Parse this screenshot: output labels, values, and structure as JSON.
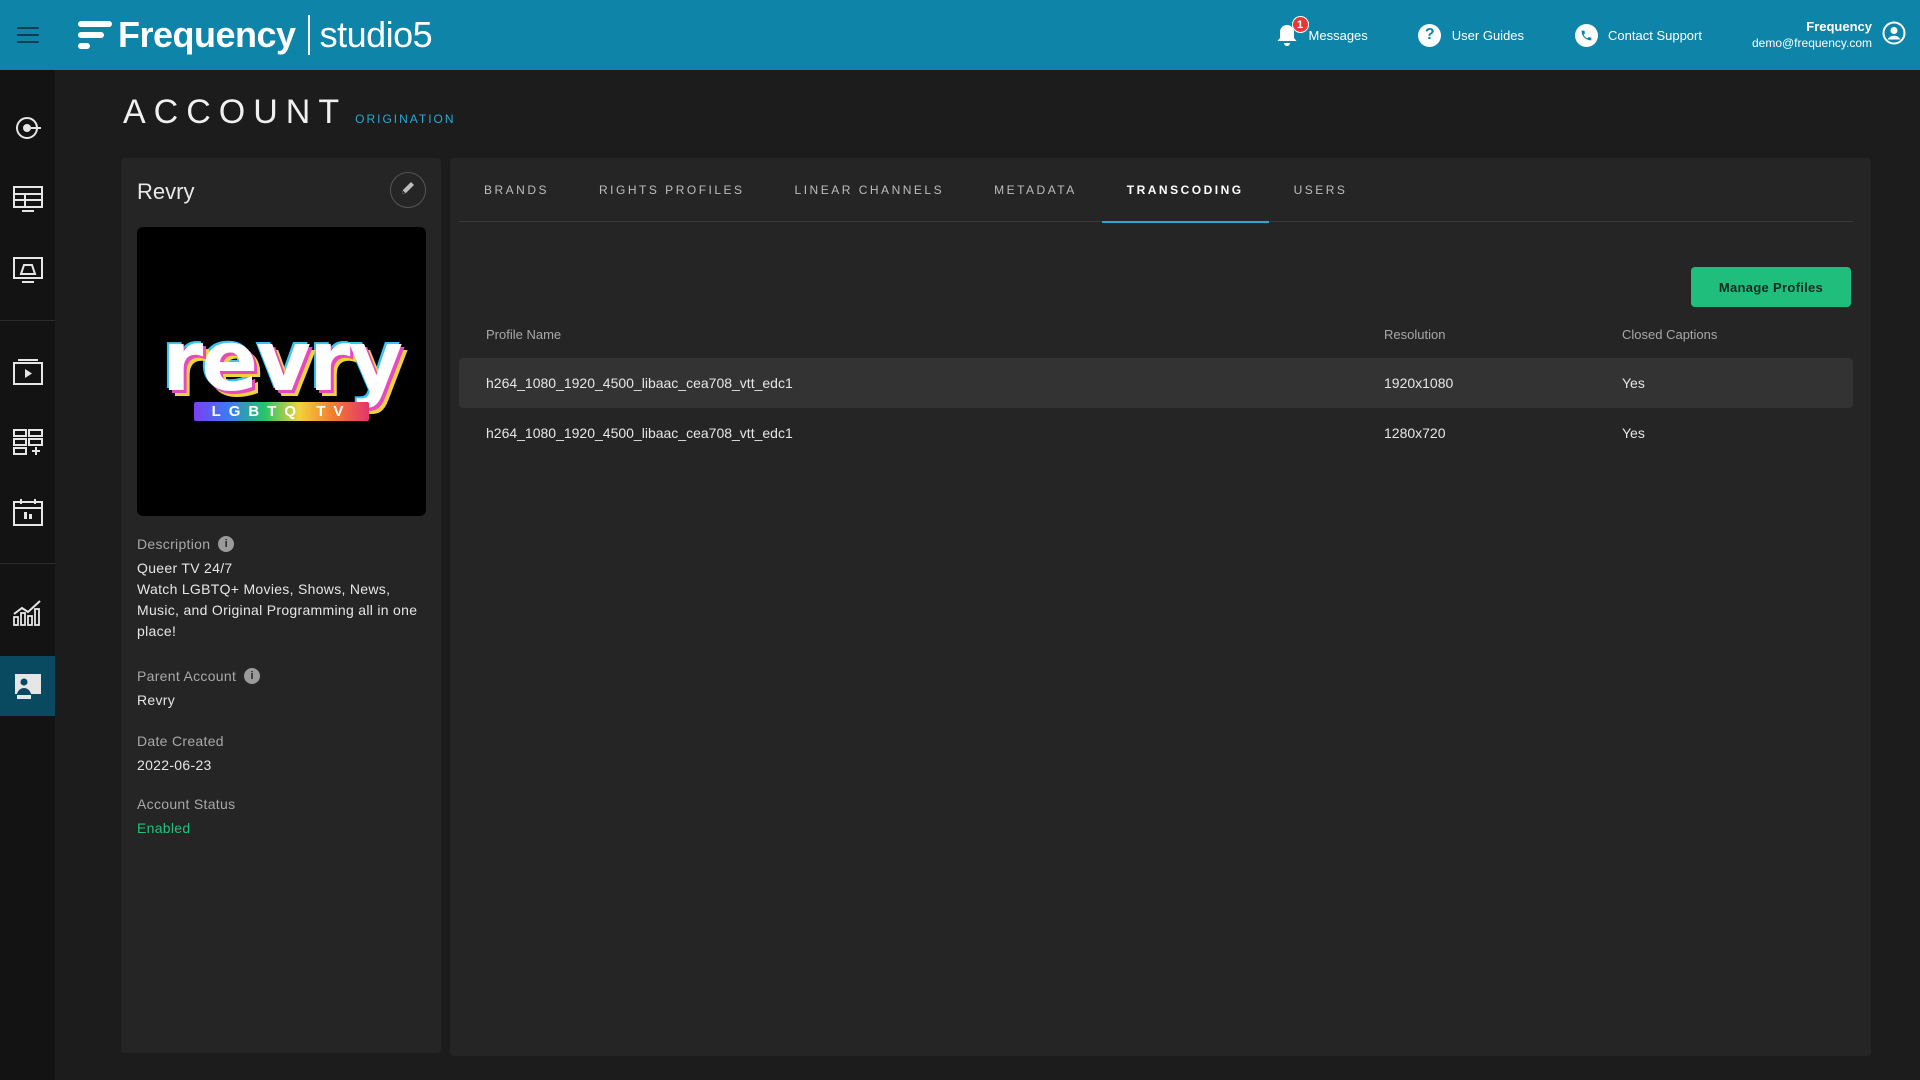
{
  "header": {
    "brand": "Frequency",
    "product": "studio5",
    "messages_label": "Messages",
    "messages_count": "1",
    "guides_label": "User Guides",
    "support_label": "Contact Support",
    "user_name": "Frequency",
    "user_email": "demo@frequency.com"
  },
  "page": {
    "title": "ACCOUNT",
    "subtitle": "ORIGINATION"
  },
  "account": {
    "name": "Revry",
    "logo_word": "revry",
    "logo_sub": "LGBTQ TV",
    "description_label": "Description",
    "description": "Queer TV 24/7\nWatch LGBTQ+ Movies, Shows, News, Music, and Original Programming all in one place!",
    "description_line1": "Queer TV 24/7",
    "description_line2": "Watch LGBTQ+ Movies, Shows, News, Music, and Original Programming all in one place!",
    "parent_label": "Parent Account",
    "parent": "Revry",
    "created_label": "Date Created",
    "created": "2022-06-23",
    "status_label": "Account Status",
    "status": "Enabled"
  },
  "tabs": [
    {
      "label": "BRANDS"
    },
    {
      "label": "RIGHTS PROFILES"
    },
    {
      "label": "LINEAR CHANNELS"
    },
    {
      "label": "METADATA"
    },
    {
      "label": "TRANSCODING"
    },
    {
      "label": "USERS"
    }
  ],
  "transcoding": {
    "manage_label": "Manage Profiles",
    "columns": [
      "Profile Name",
      "Resolution",
      "Closed Captions"
    ],
    "rows": [
      {
        "name": "h264_1080_1920_4500_libaac_cea708_vtt_edc1",
        "resolution": "1920x1080",
        "captions": "Yes"
      },
      {
        "name": "h264_1080_1920_4500_libaac_cea708_vtt_edc1",
        "resolution": "1280x720",
        "captions": "Yes"
      }
    ]
  },
  "colors": {
    "header_bg": "#0e84a9",
    "accent": "#2aa8d2",
    "success": "#1fbe7d",
    "badge": "#e53935"
  }
}
